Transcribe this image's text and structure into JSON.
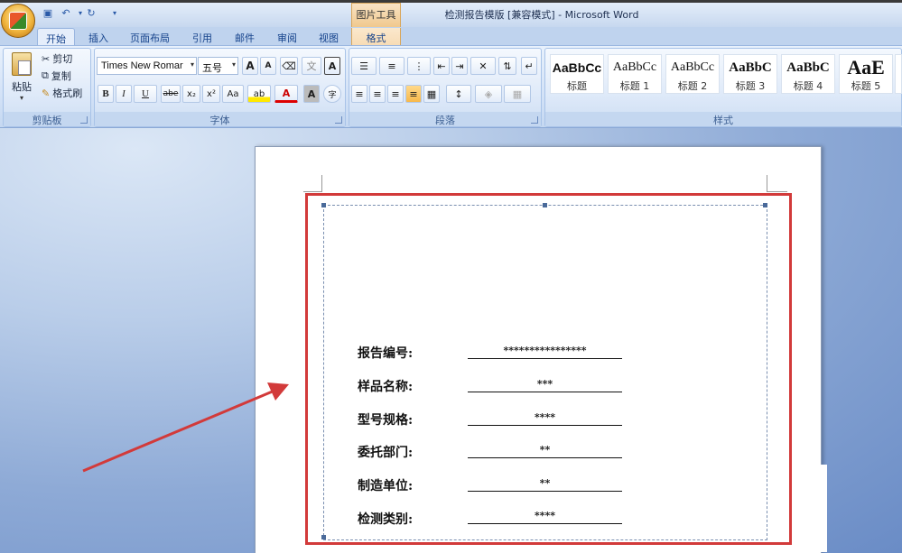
{
  "window": {
    "title": "检测报告模版 [兼容模式] - Microsoft Word",
    "context_tool": "图片工具"
  },
  "tabs": [
    {
      "label": "开始",
      "active": true
    },
    {
      "label": "插入"
    },
    {
      "label": "页面布局"
    },
    {
      "label": "引用"
    },
    {
      "label": "邮件"
    },
    {
      "label": "审阅"
    },
    {
      "label": "视图"
    },
    {
      "label": "格式",
      "context": true
    }
  ],
  "clipboard": {
    "group": "剪贴板",
    "paste": "粘贴",
    "cut": "剪切",
    "copy": "复制",
    "format_painter": "格式刷"
  },
  "font": {
    "group": "字体",
    "name": "Times New Romar",
    "size": "五号",
    "grow": "A",
    "shrink": "A",
    "bold": "B",
    "italic": "I",
    "underline": "U",
    "strike": "abe",
    "subscript": "x₂",
    "superscript": "x²",
    "change_case": "Aa",
    "highlight": "ab",
    "font_color": "A",
    "char_shading": "A",
    "enclose": "字",
    "phonetic": "文",
    "border_char": "A"
  },
  "paragraph": {
    "group": "段落"
  },
  "styles": {
    "group": "样式",
    "cards": [
      {
        "sample": "AaBbCc",
        "name": "标题"
      },
      {
        "sample": "AaBbCc",
        "name": "标题 1"
      },
      {
        "sample": "AaBbCc",
        "name": "标题 2"
      },
      {
        "sample": "AaBbC",
        "name": "标题 3"
      },
      {
        "sample": "AaBbC",
        "name": "标题 4"
      },
      {
        "sample": "AaE",
        "name": "标题 5"
      }
    ]
  },
  "document": {
    "fields": [
      {
        "label": "报告编号:",
        "value": "****************"
      },
      {
        "label": "样品名称:",
        "value": "***"
      },
      {
        "label": "型号规格:",
        "value": "****"
      },
      {
        "label": "委托部门:",
        "value": "**"
      },
      {
        "label": "制造单位:",
        "value": "**"
      },
      {
        "label": "检测类别:",
        "value": "****"
      }
    ]
  },
  "colors": {
    "annotation": "#d23a3a",
    "ribbon": "#dbe7f7",
    "workspace": "#8eaad6"
  }
}
